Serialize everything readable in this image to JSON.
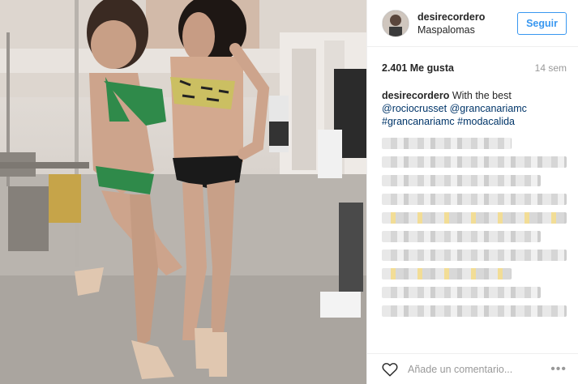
{
  "post": {
    "username": "desirecordero",
    "location": "Maspalomas",
    "follow_label": "Seguir",
    "likes": "2.401 Me gusta",
    "time_ago": "14 sem",
    "caption": {
      "username": "desirecordero",
      "text": "With the best",
      "mentions": [
        "@rociocrusset",
        "@grancanariamc"
      ],
      "hashtags": [
        "#grancanariamc",
        "#modacalida"
      ]
    },
    "comment_placeholder": "Añade un comentario...",
    "more_label": "•••"
  },
  "icons": {
    "like": "heart-icon",
    "options": "ellipsis-icon"
  },
  "colors": {
    "follow_blue": "#3897f0",
    "link": "#003569",
    "muted": "#999999"
  }
}
